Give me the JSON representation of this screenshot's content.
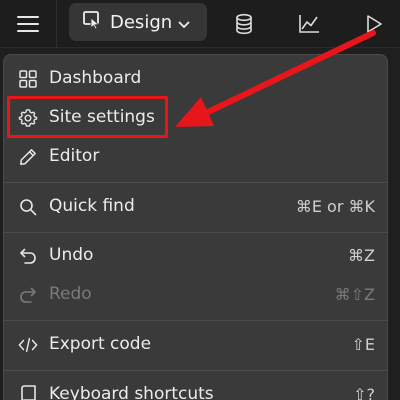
{
  "toolbar": {
    "mode_label": "Design",
    "icons": [
      "menu-icon",
      "design-cursor-icon",
      "chevron-down-icon",
      "database-icon",
      "analytics-icon",
      "play-icon"
    ]
  },
  "menu": {
    "items": [
      {
        "label": "Dashboard",
        "icon": "grid-icon",
        "shortcut": ""
      },
      {
        "label": "Site settings",
        "icon": "gear-icon",
        "shortcut": ""
      },
      {
        "label": "Editor",
        "icon": "pencil-icon",
        "shortcut": ""
      },
      {
        "label": "Quick find",
        "icon": "search-icon",
        "shortcut": "⌘E or ⌘K"
      },
      {
        "label": "Undo",
        "icon": "undo-icon",
        "shortcut": "⌘Z"
      },
      {
        "label": "Redo",
        "icon": "redo-icon",
        "shortcut": "⌘⇧Z"
      },
      {
        "label": "Export code",
        "icon": "code-icon",
        "shortcut": "⇧E"
      },
      {
        "label": "Keyboard shortcuts",
        "icon": "keyboard-icon",
        "shortcut": "⇧?"
      }
    ]
  },
  "annotation": {
    "color": "#e8161b",
    "target": "Site settings"
  }
}
